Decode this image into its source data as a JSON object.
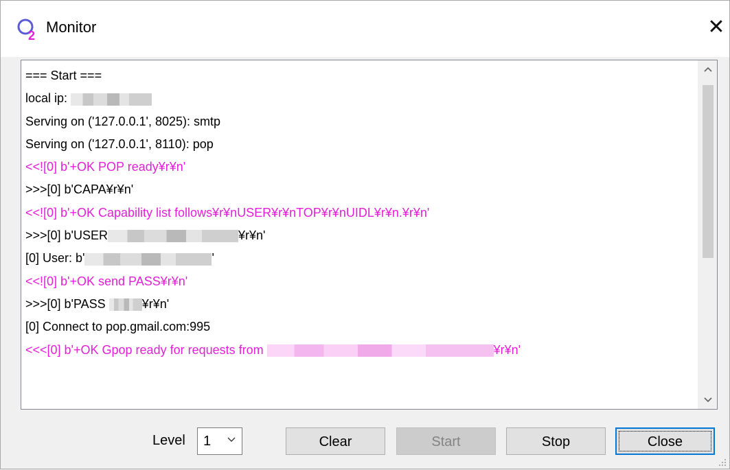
{
  "window": {
    "title": "Monitor",
    "close_glyph": "✕"
  },
  "log": {
    "lines": [
      {
        "parts": [
          "=== Start ==="
        ],
        "color": "black"
      },
      {
        "parts": [
          "local ip: ",
          "[redacted]"
        ],
        "color": "black"
      },
      {
        "parts": [
          "Serving on ('127.0.0.1', 8025): smtp"
        ],
        "color": "black"
      },
      {
        "parts": [
          "Serving on ('127.0.0.1', 8110): pop"
        ],
        "color": "black"
      },
      {
        "parts": [
          "<<![0] b'+OK POP ready¥r¥n'"
        ],
        "color": "pink"
      },
      {
        "parts": [
          ">>>[0] b'CAPA¥r¥n'"
        ],
        "color": "black"
      },
      {
        "parts": [
          "<<![0] b'+OK Capability list follows¥r¥nUSER¥r¥nTOP¥r¥nUIDL¥r¥n.¥r¥n'"
        ],
        "color": "pink"
      },
      {
        "parts": [
          ">>>[0] b'USER",
          "[redacted]",
          "¥r¥n'"
        ],
        "color": "black"
      },
      {
        "parts": [
          "[0] User: b'",
          "[redacted]",
          "'"
        ],
        "color": "black"
      },
      {
        "parts": [
          "<<![0] b'+OK send PASS¥r¥n'"
        ],
        "color": "pink"
      },
      {
        "parts": [
          ">>>[0] b'PASS ",
          "[redacted]",
          "¥r¥n'"
        ],
        "color": "black"
      },
      {
        "parts": [
          "[0] Connect to pop.gmail.com:995"
        ],
        "color": "black"
      },
      {
        "parts": [
          "<<<[0] b'+OK Gpop ready for requests from ",
          "[redacted]",
          "¥r¥n'"
        ],
        "color": "pink"
      }
    ]
  },
  "controls": {
    "level_label": "Level",
    "level_value": "1",
    "clear_label": "Clear",
    "start_label": "Start",
    "stop_label": "Stop",
    "close_label": "Close"
  },
  "colors": {
    "pink_text": "#e31ed8",
    "focus_border": "#0078d7"
  },
  "icons": {
    "app": "monitor-app-icon",
    "close": "close-icon",
    "scroll_up": "chevron-up-icon",
    "scroll_down": "chevron-down-icon",
    "dropdown": "chevron-down-icon"
  }
}
